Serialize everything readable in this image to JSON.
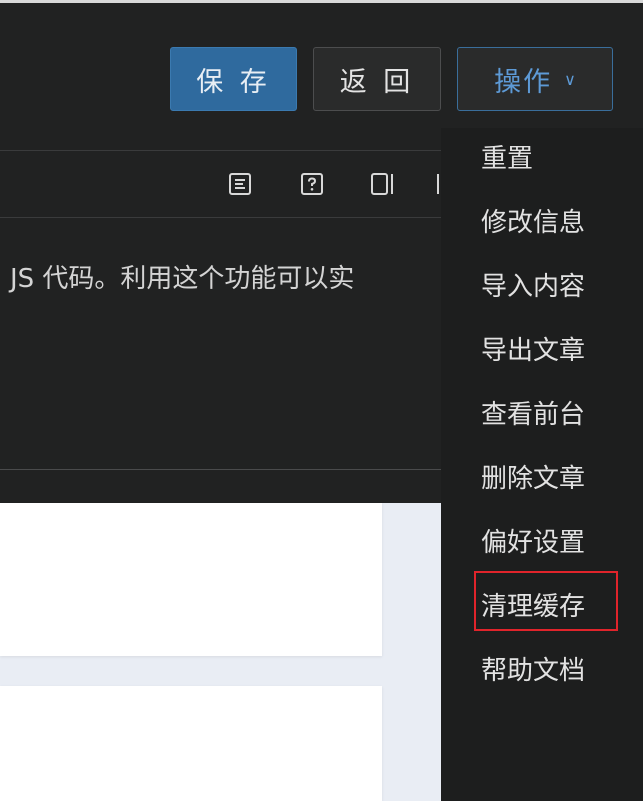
{
  "header": {
    "save_label": "保 存",
    "back_label": "返 回",
    "ops_label": "操作",
    "ops_chevron": "∨"
  },
  "toolbar": {
    "icons": [
      "align-left-icon",
      "help-icon",
      "panel-right-icon",
      "panel-left-icon"
    ]
  },
  "description": {
    "text": "JS 代码。利用这个功能可以实"
  },
  "menu": {
    "items": [
      "重置",
      "修改信息",
      "导入内容",
      "导出文章",
      "查看前台",
      "删除文章",
      "偏好设置",
      "清理缓存",
      "帮助文档"
    ],
    "highlighted_index": 7
  },
  "colors": {
    "dark_bg": "#212222",
    "primary": "#2f6a9e",
    "accent_text": "#5d9ad6",
    "highlight": "#e0242b"
  }
}
